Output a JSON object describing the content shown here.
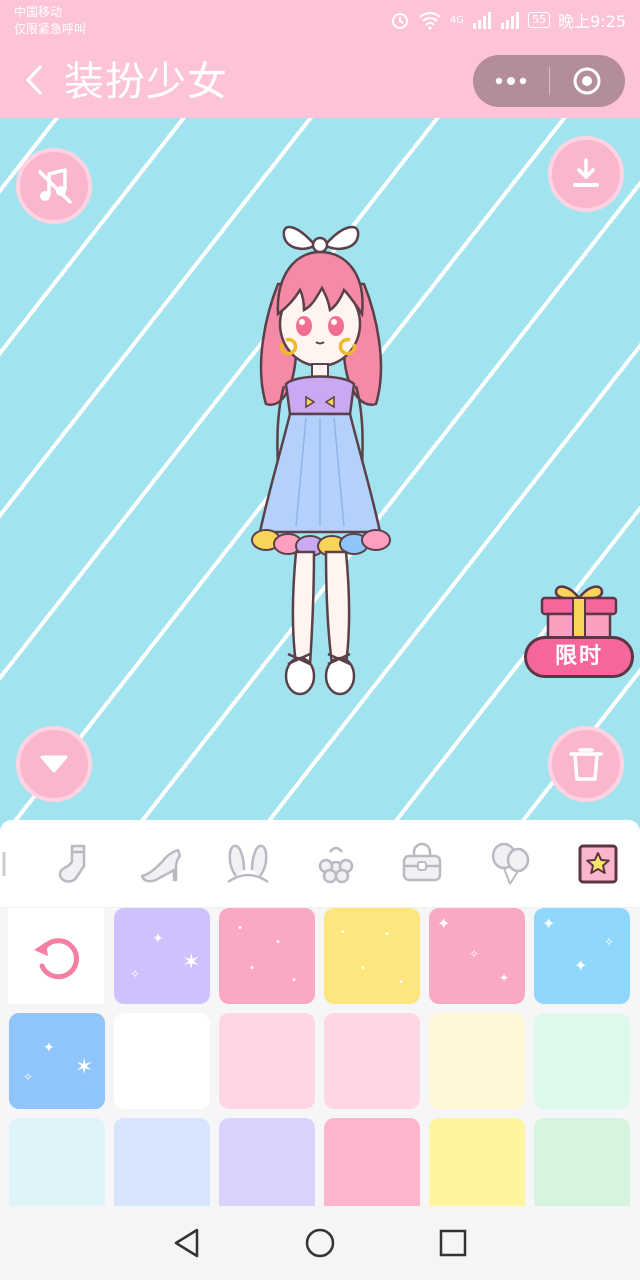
{
  "status_bar": {
    "carrier": "中国移动",
    "emergency_note": "仅限紧急呼叫",
    "network": "4G",
    "battery": "55",
    "time": "晚上9:25"
  },
  "header": {
    "title": "装扮少女"
  },
  "stage": {
    "gift_label": "限时"
  },
  "categories": [
    "socks",
    "shoes",
    "bunny-ears",
    "flower-accessory",
    "bag",
    "balloons",
    "background"
  ],
  "colors": {
    "header_pink": "#fdc4d8",
    "button_pink": "#f9b6cc",
    "stage_blue": "#a2e3f0",
    "gift_tag": "#f5679b"
  },
  "swatches": {
    "row1": [
      "#cfc1fb",
      "#fba8c3",
      "#fde67e",
      "#fba8c3",
      "#8fd8fb"
    ],
    "row2": [
      "#8fc5fb",
      "#ffffff",
      "#ffd6e3",
      "#ffd6e3",
      "#fff8d6",
      "#dcf9ec"
    ],
    "row3": [
      "#dff3fb",
      "#d6e4fe",
      "#dcd3fd",
      "#feb4cc",
      "#fff49f",
      "#d7f4de"
    ]
  }
}
